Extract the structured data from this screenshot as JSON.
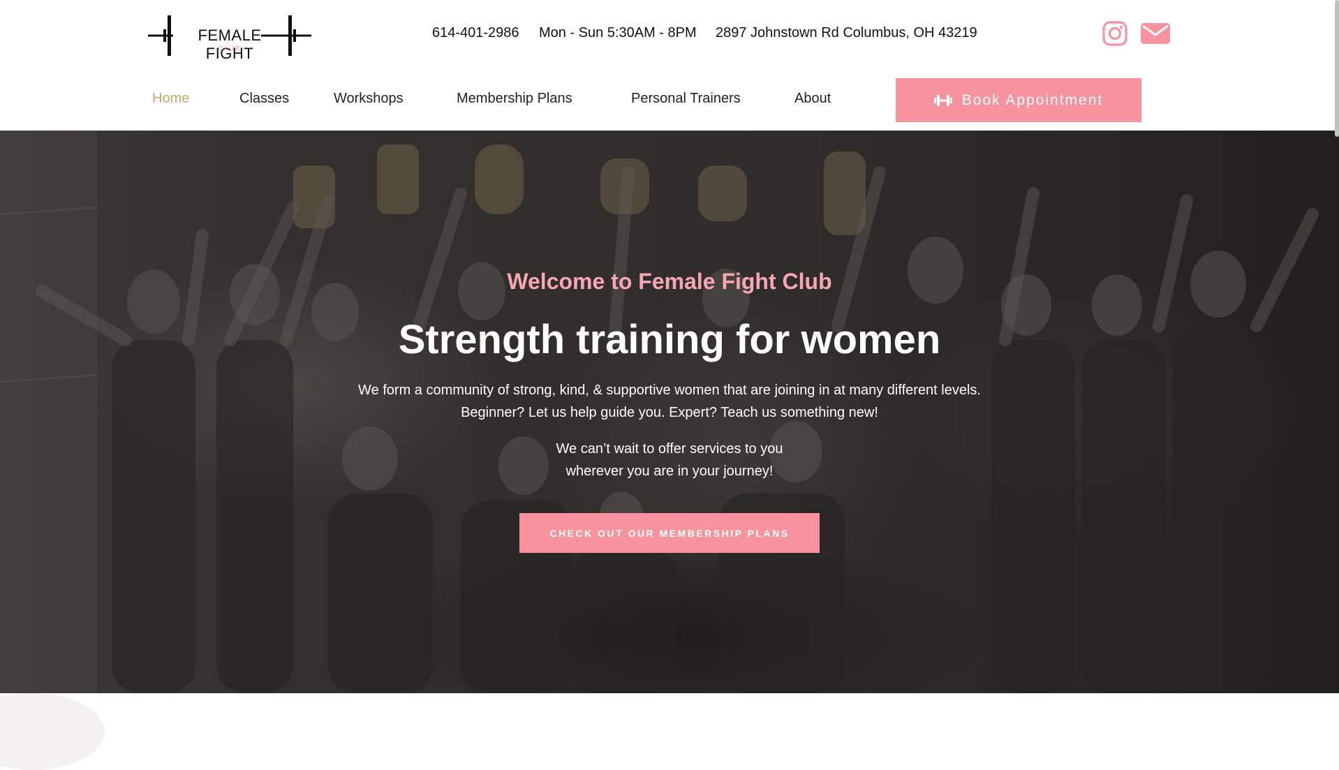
{
  "brand": {
    "logo_main": "FEMALE FIGHT",
    "logo_sub": "CLUB",
    "accent_color": "#f6939f",
    "active_nav_color": "#c9a96e"
  },
  "header": {
    "phone": "614-401-2986",
    "hours": "Mon - Sun 5:30AM - 8PM",
    "address": "2897 Johnstown Rd Columbus, OH 43219",
    "social": [
      {
        "icon": "instagram-icon"
      },
      {
        "icon": "mail-icon"
      }
    ]
  },
  "nav": {
    "items": [
      {
        "label": "Home",
        "active": true
      },
      {
        "label": "Classes"
      },
      {
        "label": "Workshops"
      },
      {
        "label": "Membership Plans"
      },
      {
        "label": "Personal Trainers"
      },
      {
        "label": "About"
      }
    ],
    "book_button": {
      "label": "Book Appointment",
      "icon": "dumbbell-icon"
    }
  },
  "hero": {
    "eyebrow": "Welcome to Female Fight Club",
    "title": "Strength training for women",
    "paragraph1": [
      "We form a community of strong, kind, & supportive women that are joining in at many different levels.",
      "Beginner? Let us help guide you. Expert? Teach us something new!"
    ],
    "paragraph2": [
      "We can’t wait to offer services to you",
      "wherever you are in your journey!"
    ],
    "cta_label": "CHECK OUT OUR MEMBERSHIP PLANS"
  }
}
